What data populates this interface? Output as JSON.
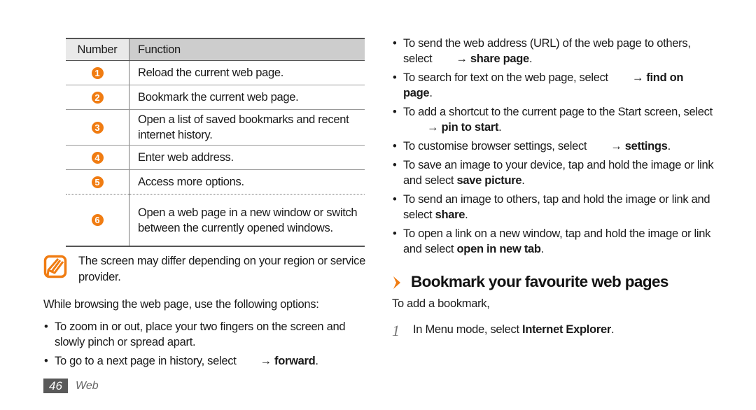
{
  "table": {
    "headers": {
      "number": "Number",
      "function": "Function"
    },
    "rows": [
      {
        "number": "1",
        "function": "Reload the current web page."
      },
      {
        "number": "2",
        "function": "Bookmark the current web page."
      },
      {
        "number": "3",
        "function": "Open a list of saved bookmarks and recent internet history."
      },
      {
        "number": "4",
        "function": "Enter web address."
      },
      {
        "number": "5",
        "function": "Access more options."
      },
      {
        "number": "6",
        "function": "Open a web page in a new window or switch between the currently opened windows."
      }
    ]
  },
  "note": {
    "icon": "pencil-note-icon",
    "text": "The screen may differ depending on your region or service provider."
  },
  "intro": "While browsing the web page, use the following options:",
  "left_bullets": [
    {
      "text": "To zoom in or out, place your two fingers on the screen and slowly pinch or spread apart."
    },
    {
      "pre": "To go to a next page in history, select",
      "arrow": "→",
      "bold": "forward",
      "post": "."
    }
  ],
  "right_bullets": [
    {
      "pre": "To send the web address (URL) of the web page to others, select",
      "arrow": "→",
      "bold": "share page",
      "post": "."
    },
    {
      "pre": "To search for text on the web page, select",
      "arrow": "→",
      "bold": "find on page",
      "post": "."
    },
    {
      "pre": "To add a shortcut to the current page to the Start screen, select",
      "arrow": "→",
      "bold": "pin to start",
      "post": "."
    },
    {
      "pre": "To customise browser settings, select",
      "arrow": "→",
      "bold": "settings",
      "post": "."
    },
    {
      "pre": "To save an image to your device, tap and hold the image or link and select",
      "arrow": "",
      "bold": "save picture",
      "post": "."
    },
    {
      "pre": "To send an image to others, tap and hold the image or link and select",
      "arrow": "",
      "bold": "share",
      "post": "."
    },
    {
      "pre": "To open a link on a new window, tap and hold the image or link and select",
      "arrow": "",
      "bold": "open in new tab",
      "post": "."
    }
  ],
  "section": {
    "icon": "chevron-right-icon",
    "title": "Bookmark your favourite web pages",
    "subtitle": "To add a bookmark,",
    "steps": [
      {
        "number": "1",
        "pre": "In Menu mode, select",
        "bold": "Internet Explorer",
        "post": "."
      }
    ]
  },
  "footer": {
    "page_number": "46",
    "section": "Web"
  },
  "colors": {
    "accent": "#f07c12",
    "header_dark": "#cdcdcd",
    "header_light": "#e9e9e9",
    "page_box": "#595959"
  }
}
